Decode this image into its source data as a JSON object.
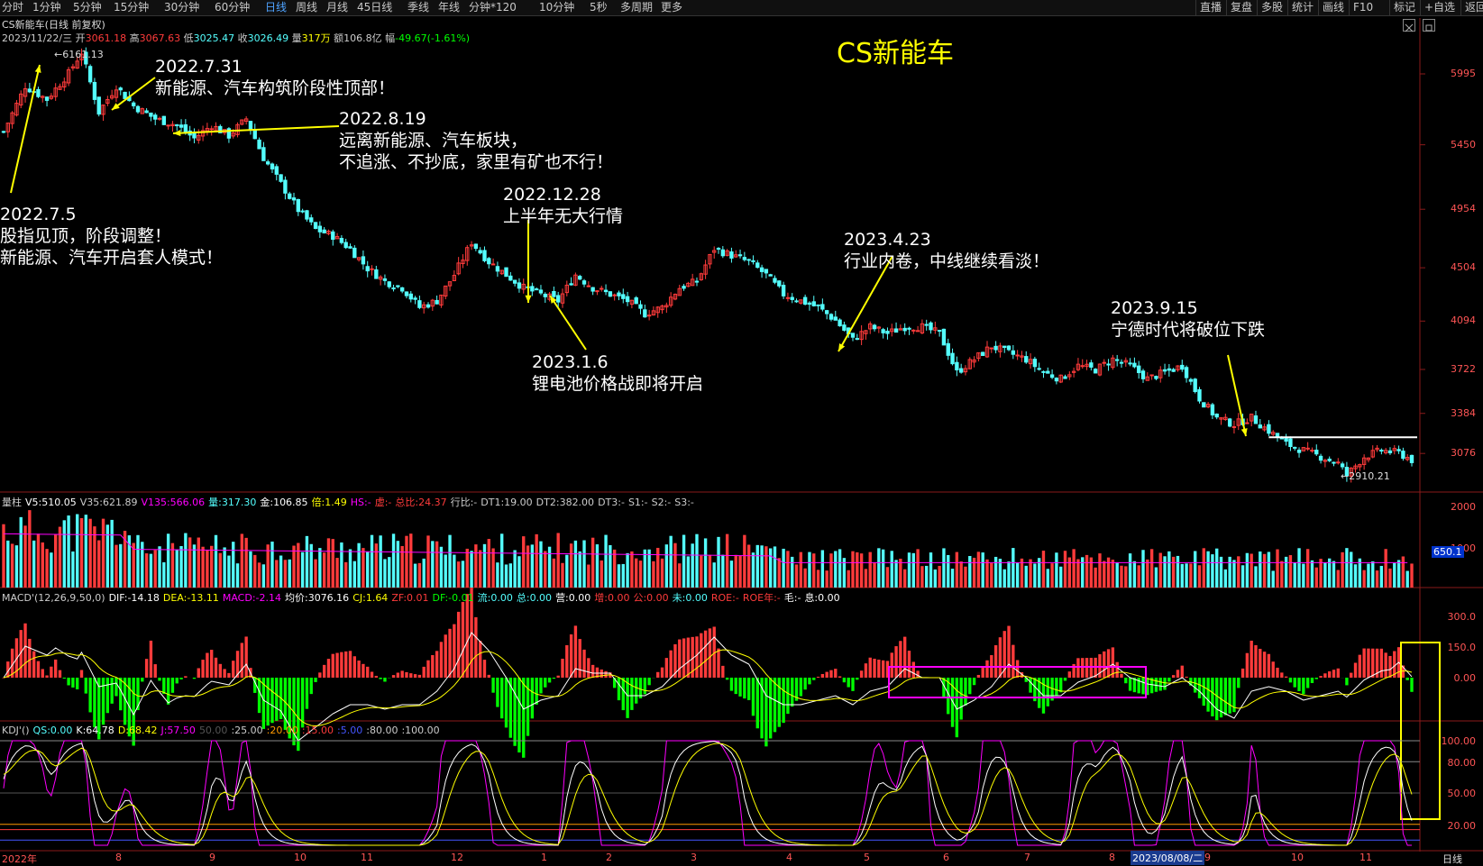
{
  "toolbar": {
    "left": [
      "分时",
      "1分钟",
      "5分钟",
      "15分钟",
      "30分钟",
      "60分钟",
      "日线",
      "周线",
      "月线",
      "45日线",
      "季线",
      "年线",
      "分钟*120",
      "10分钟",
      "5秒",
      "多周期",
      "更多"
    ],
    "active": "日线",
    "right": [
      "直播",
      "复盘",
      "多股",
      "统计",
      "画线",
      "F10",
      "标记",
      "+自选",
      "返回"
    ]
  },
  "header": {
    "title": "CS新能车(日线 前复权)",
    "date": "2023/11/22/三",
    "open_label": "开",
    "open": "3061.18",
    "high_label": "高",
    "high": "3067.63",
    "low_label": "低",
    "low": "3025.47",
    "close_label": "收",
    "close": "3026.49",
    "vol_label": "量",
    "vol": "317万",
    "amt_label": "额",
    "amt": "106.8亿",
    "chg_label": "幅",
    "chg": "-49.67(-1.61%)"
  },
  "big_title": "CS新能车",
  "annotations": [
    {
      "id": "a1",
      "lines": [
        "2022.7.5",
        "股指见顶，阶段调整！",
        "新能源、汽车开启套人模式！"
      ]
    },
    {
      "id": "a2",
      "lines": [
        "2022.7.31",
        "新能源、汽车构筑阶段性顶部！"
      ]
    },
    {
      "id": "a3",
      "lines": [
        "2022.8.19",
        "远离新能源、汽车板块，",
        "不追涨、不抄底，家里有矿也不行！"
      ]
    },
    {
      "id": "a4",
      "lines": [
        "2022.12.28",
        "上半年无大行情"
      ]
    },
    {
      "id": "a5",
      "lines": [
        "2023.1.6",
        "锂电池价格战即将开启"
      ]
    },
    {
      "id": "a6",
      "lines": [
        "2023.4.23",
        "行业内卷，中线继续看淡！"
      ]
    },
    {
      "id": "a7",
      "lines": [
        "2023.9.15",
        "宁德时代将破位下跌"
      ]
    }
  ],
  "price_marks": {
    "high": "6161.13",
    "low": "2910.21"
  },
  "colors": {
    "up": "#ff3b3b",
    "down": "#54ffff",
    "ma": "#ffff00",
    "magenta": "#ff00ff",
    "axis": "#ff5555",
    "white": "#ffffff"
  },
  "vol_panel": {
    "items": [
      {
        "k": "量柱",
        "v": "",
        "c": "#cccccc"
      },
      {
        "k": "V5:",
        "v": "510.05",
        "c": "#ffffff"
      },
      {
        "k": "V35:",
        "v": "621.89",
        "c": "#cccccc"
      },
      {
        "k": "V135:",
        "v": "566.06",
        "c": "#ff00ff"
      },
      {
        "k": "量:",
        "v": "317.30",
        "c": "#54ffff"
      },
      {
        "k": "金:",
        "v": "106.85",
        "c": "#ffffff"
      },
      {
        "k": "倍:",
        "v": "1.49",
        "c": "#ffff00"
      },
      {
        "k": "HS:",
        "v": "-",
        "c": "#ff00ff"
      },
      {
        "k": "虚:",
        "v": "-",
        "c": "#ff3b3b"
      },
      {
        "k": "总比:",
        "v": "24.37",
        "c": "#ff3b3b"
      },
      {
        "k": "行比:",
        "v": "-",
        "c": "#cccccc"
      },
      {
        "k": "DT1:",
        "v": "19.00",
        "c": "#cccccc"
      },
      {
        "k": "DT2:",
        "v": "382.00",
        "c": "#cccccc"
      },
      {
        "k": "DT3:",
        "v": "-",
        "c": "#cccccc"
      },
      {
        "k": "S1:",
        "v": "-",
        "c": "#cccccc"
      },
      {
        "k": "S2:",
        "v": "-",
        "c": "#cccccc"
      },
      {
        "k": "S3:",
        "v": "-",
        "c": "#cccccc"
      }
    ],
    "axis": [
      "2000",
      "1000"
    ],
    "badge": "650.1"
  },
  "macd_panel": {
    "items": [
      {
        "k": "MACD'(12,26,9,50,0)",
        "v": "",
        "c": "#cccccc"
      },
      {
        "k": "DIF:",
        "v": "-14.18",
        "c": "#ffffff"
      },
      {
        "k": "DEA:",
        "v": "-13.11",
        "c": "#ffff00"
      },
      {
        "k": "MACD:",
        "v": "-2.14",
        "c": "#ff00ff"
      },
      {
        "k": "均价:",
        "v": "3076.16",
        "c": "#ffffff"
      },
      {
        "k": "CJ:",
        "v": "1.64",
        "c": "#ffff00"
      },
      {
        "k": "ZF:",
        "v": "0.01",
        "c": "#ff3b3b"
      },
      {
        "k": "DF:",
        "v": "-0.01",
        "c": "#00ff00"
      },
      {
        "k": "流:",
        "v": "0.00",
        "c": "#54ffff"
      },
      {
        "k": "总:",
        "v": "0.00",
        "c": "#54ffff"
      },
      {
        "k": "营:",
        "v": "0.00",
        "c": "#ffffff"
      },
      {
        "k": "增:",
        "v": "0.00",
        "c": "#ff3b3b"
      },
      {
        "k": "公:",
        "v": "0.00",
        "c": "#ff3b3b"
      },
      {
        "k": "未:",
        "v": "0.00",
        "c": "#54ffff"
      },
      {
        "k": "ROE:",
        "v": "-",
        "c": "#ff3b3b"
      },
      {
        "k": "ROE年:",
        "v": "-",
        "c": "#ff3b3b"
      },
      {
        "k": "毛:",
        "v": "-",
        "c": "#ffffff"
      },
      {
        "k": "息:",
        "v": "0.00",
        "c": "#ffffff"
      }
    ],
    "axis": [
      "300.0",
      "150.0",
      "0.00"
    ]
  },
  "kdj_panel": {
    "items": [
      {
        "k": "KDJ'(",
        "v": ")",
        "c": "#cccccc"
      },
      {
        "k": "QS:",
        "v": "0.00",
        "c": "#54ffff"
      },
      {
        "k": "K:",
        "v": "64.78",
        "c": "#ffffff"
      },
      {
        "k": "D:",
        "v": "68.42",
        "c": "#ffff00"
      },
      {
        "k": "J:",
        "v": "57.50",
        "c": "#ff00ff"
      },
      {
        "k": "",
        "v": "50.00",
        "c": "#555555"
      },
      {
        "k": ":",
        "v": "25.00",
        "c": "#cccccc"
      },
      {
        "k": ":",
        "v": "20.00",
        "c": "#ff9900"
      },
      {
        "k": ":",
        "v": "15.00",
        "c": "#ff3b3b"
      },
      {
        "k": ":",
        "v": "5.00",
        "c": "#4455ff"
      },
      {
        "k": ":",
        "v": "80.00",
        "c": "#cccccc"
      },
      {
        "k": ":",
        "v": "100.00",
        "c": "#cccccc"
      }
    ],
    "axis": [
      "100.00",
      "80.00",
      "50.00",
      "20.00"
    ]
  },
  "x_axis": {
    "labels": [
      "2022年",
      "8",
      "9",
      "10",
      "11",
      "12",
      "1",
      "2",
      "3",
      "4",
      "5",
      "6",
      "7",
      "8",
      "9",
      "10",
      "11"
    ],
    "cursor": "2023/08/08/二",
    "period": "日线"
  },
  "chart_data": {
    "type": "candlestick",
    "title": "CS新能车(日线 前复权)",
    "y_ticks": [
      5995,
      5450,
      4954,
      4504,
      4094,
      3722,
      3384,
      3076
    ],
    "ylim": [
      2800,
      6300
    ],
    "x_period": [
      "2022-07",
      "2023-11"
    ],
    "close_path": [
      [
        0,
        5550
      ],
      [
        5,
        5900
      ],
      [
        10,
        5800
      ],
      [
        15,
        6000
      ],
      [
        18,
        6161
      ],
      [
        22,
        5700
      ],
      [
        26,
        5900
      ],
      [
        30,
        5750
      ],
      [
        35,
        5650
      ],
      [
        40,
        5600
      ],
      [
        44,
        5500
      ],
      [
        48,
        5600
      ],
      [
        52,
        5520
      ],
      [
        56,
        5650
      ],
      [
        60,
        5350
      ],
      [
        64,
        5150
      ],
      [
        68,
        4950
      ],
      [
        72,
        4800
      ],
      [
        76,
        4750
      ],
      [
        80,
        4650
      ],
      [
        84,
        4500
      ],
      [
        88,
        4400
      ],
      [
        92,
        4350
      ],
      [
        96,
        4200
      ],
      [
        100,
        4250
      ],
      [
        104,
        4450
      ],
      [
        108,
        4700
      ],
      [
        112,
        4550
      ],
      [
        116,
        4450
      ],
      [
        120,
        4350
      ],
      [
        124,
        4300
      ],
      [
        128,
        4250
      ],
      [
        132,
        4450
      ],
      [
        136,
        4350
      ],
      [
        140,
        4300
      ],
      [
        144,
        4250
      ],
      [
        148,
        4150
      ],
      [
        152,
        4200
      ],
      [
        156,
        4350
      ],
      [
        160,
        4400
      ],
      [
        164,
        4650
      ],
      [
        168,
        4600
      ],
      [
        172,
        4550
      ],
      [
        176,
        4450
      ],
      [
        180,
        4300
      ],
      [
        184,
        4250
      ],
      [
        188,
        4200
      ],
      [
        192,
        4100
      ],
      [
        196,
        3950
      ],
      [
        200,
        4050
      ],
      [
        204,
        4000
      ],
      [
        208,
        4050
      ],
      [
        212,
        4050
      ],
      [
        216,
        4000
      ],
      [
        220,
        3700
      ],
      [
        224,
        3800
      ],
      [
        228,
        3900
      ],
      [
        232,
        3850
      ],
      [
        236,
        3800
      ],
      [
        240,
        3700
      ],
      [
        244,
        3650
      ],
      [
        248,
        3750
      ],
      [
        252,
        3720
      ],
      [
        256,
        3800
      ],
      [
        260,
        3750
      ],
      [
        264,
        3650
      ],
      [
        268,
        3700
      ],
      [
        272,
        3750
      ],
      [
        276,
        3500
      ],
      [
        280,
        3350
      ],
      [
        284,
        3300
      ],
      [
        288,
        3350
      ],
      [
        292,
        3250
      ],
      [
        296,
        3150
      ],
      [
        300,
        3100
      ],
      [
        304,
        3050
      ],
      [
        308,
        3000
      ],
      [
        310,
        2910
      ],
      [
        314,
        3050
      ],
      [
        318,
        3100
      ],
      [
        322,
        3080
      ],
      [
        325,
        3026
      ]
    ],
    "high": 6161.13,
    "low": 2910.21,
    "support_line": 3200,
    "indicators": {
      "volume": {
        "V5": 510.05,
        "V35": 621.89,
        "V135": 566.06,
        "vol": 317.3,
        "ylim": [
          0,
          2000
        ]
      },
      "macd": {
        "DIF": -14.18,
        "DEA": -13.11,
        "MACD": -2.14,
        "ylim": [
          -100,
          300
        ]
      },
      "kdj": {
        "K": 64.78,
        "D": 68.42,
        "J": 57.5,
        "levels": [
          100,
          80,
          50,
          20
        ],
        "ylim": [
          0,
          100
        ]
      }
    }
  }
}
